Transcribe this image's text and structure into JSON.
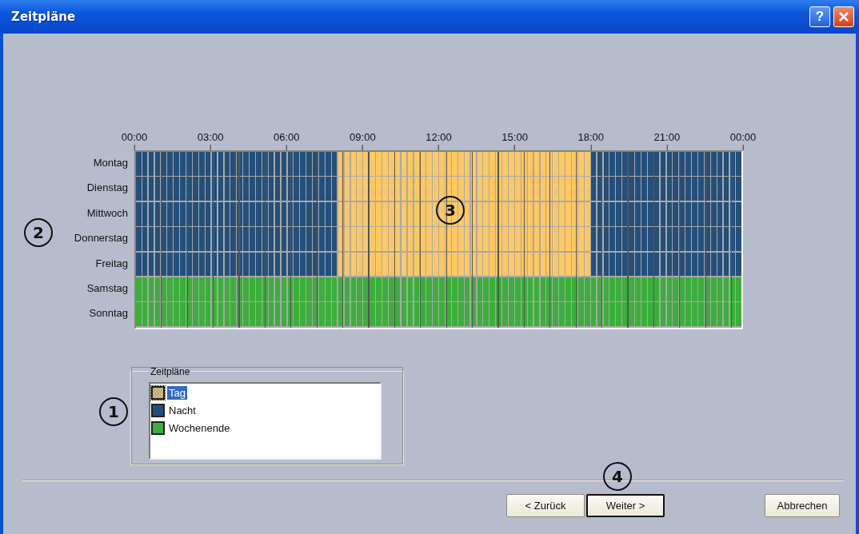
{
  "window": {
    "title": "Zeitpläne",
    "controls": [
      {
        "kind": "help",
        "label": "?"
      },
      {
        "kind": "close"
      }
    ]
  },
  "timeline": {
    "ticks": [
      "00:00",
      "03:00",
      "06:00",
      "09:00",
      "12:00",
      "15:00",
      "18:00",
      "21:00",
      "00:00"
    ],
    "days": [
      {
        "label": "Montag",
        "hours": [
          {
            "kind": "night"
          },
          {
            "kind": "night"
          },
          {
            "kind": "night"
          },
          {
            "kind": "night"
          },
          {
            "kind": "night"
          },
          {
            "kind": "night"
          },
          {
            "kind": "night"
          },
          {
            "kind": "night"
          },
          {
            "kind": "day"
          },
          {
            "kind": "day"
          },
          {
            "kind": "day"
          },
          {
            "kind": "day"
          },
          {
            "kind": "day"
          },
          {
            "kind": "day"
          },
          {
            "kind": "day"
          },
          {
            "kind": "day"
          },
          {
            "kind": "day"
          },
          {
            "kind": "day"
          },
          {
            "kind": "night"
          },
          {
            "kind": "night"
          },
          {
            "kind": "night"
          },
          {
            "kind": "night"
          },
          {
            "kind": "night"
          },
          {
            "kind": "night"
          }
        ]
      },
      {
        "label": "Dienstag",
        "hours": [
          {
            "kind": "night"
          },
          {
            "kind": "night"
          },
          {
            "kind": "night"
          },
          {
            "kind": "night"
          },
          {
            "kind": "night"
          },
          {
            "kind": "night"
          },
          {
            "kind": "night"
          },
          {
            "kind": "night"
          },
          {
            "kind": "day"
          },
          {
            "kind": "day"
          },
          {
            "kind": "day"
          },
          {
            "kind": "day"
          },
          {
            "kind": "day"
          },
          {
            "kind": "day"
          },
          {
            "kind": "day"
          },
          {
            "kind": "day"
          },
          {
            "kind": "day"
          },
          {
            "kind": "day"
          },
          {
            "kind": "night"
          },
          {
            "kind": "night"
          },
          {
            "kind": "night"
          },
          {
            "kind": "night"
          },
          {
            "kind": "night"
          },
          {
            "kind": "night"
          }
        ]
      },
      {
        "label": "Mittwoch",
        "hours": [
          {
            "kind": "night"
          },
          {
            "kind": "night"
          },
          {
            "kind": "night"
          },
          {
            "kind": "night"
          },
          {
            "kind": "night"
          },
          {
            "kind": "night"
          },
          {
            "kind": "night"
          },
          {
            "kind": "night"
          },
          {
            "kind": "day"
          },
          {
            "kind": "day"
          },
          {
            "kind": "day"
          },
          {
            "kind": "day"
          },
          {
            "kind": "day"
          },
          {
            "kind": "day"
          },
          {
            "kind": "day"
          },
          {
            "kind": "day"
          },
          {
            "kind": "day"
          },
          {
            "kind": "day"
          },
          {
            "kind": "night"
          },
          {
            "kind": "night"
          },
          {
            "kind": "night"
          },
          {
            "kind": "night"
          },
          {
            "kind": "night"
          },
          {
            "kind": "night"
          }
        ]
      },
      {
        "label": "Donnerstag",
        "hours": [
          {
            "kind": "night"
          },
          {
            "kind": "night"
          },
          {
            "kind": "night"
          },
          {
            "kind": "night"
          },
          {
            "kind": "night"
          },
          {
            "kind": "night"
          },
          {
            "kind": "night"
          },
          {
            "kind": "night"
          },
          {
            "kind": "day"
          },
          {
            "kind": "day"
          },
          {
            "kind": "day"
          },
          {
            "kind": "day"
          },
          {
            "kind": "day"
          },
          {
            "kind": "day"
          },
          {
            "kind": "day"
          },
          {
            "kind": "day"
          },
          {
            "kind": "day"
          },
          {
            "kind": "day"
          },
          {
            "kind": "night"
          },
          {
            "kind": "night"
          },
          {
            "kind": "night"
          },
          {
            "kind": "night"
          },
          {
            "kind": "night"
          },
          {
            "kind": "night"
          }
        ]
      },
      {
        "label": "Freitag",
        "hours": [
          {
            "kind": "night"
          },
          {
            "kind": "night"
          },
          {
            "kind": "night"
          },
          {
            "kind": "night"
          },
          {
            "kind": "night"
          },
          {
            "kind": "night"
          },
          {
            "kind": "night"
          },
          {
            "kind": "night"
          },
          {
            "kind": "day"
          },
          {
            "kind": "day"
          },
          {
            "kind": "day"
          },
          {
            "kind": "day"
          },
          {
            "kind": "day"
          },
          {
            "kind": "day"
          },
          {
            "kind": "day"
          },
          {
            "kind": "day"
          },
          {
            "kind": "day"
          },
          {
            "kind": "day"
          },
          {
            "kind": "night"
          },
          {
            "kind": "night"
          },
          {
            "kind": "night"
          },
          {
            "kind": "night"
          },
          {
            "kind": "night"
          },
          {
            "kind": "night"
          }
        ]
      },
      {
        "label": "Samstag",
        "hours": [
          {
            "kind": "weekend"
          },
          {
            "kind": "weekend"
          },
          {
            "kind": "weekend"
          },
          {
            "kind": "weekend"
          },
          {
            "kind": "weekend"
          },
          {
            "kind": "weekend"
          },
          {
            "kind": "weekend"
          },
          {
            "kind": "weekend"
          },
          {
            "kind": "weekend"
          },
          {
            "kind": "weekend"
          },
          {
            "kind": "weekend"
          },
          {
            "kind": "weekend"
          },
          {
            "kind": "weekend"
          },
          {
            "kind": "weekend"
          },
          {
            "kind": "weekend"
          },
          {
            "kind": "weekend"
          },
          {
            "kind": "weekend"
          },
          {
            "kind": "weekend"
          },
          {
            "kind": "weekend"
          },
          {
            "kind": "weekend"
          },
          {
            "kind": "weekend"
          },
          {
            "kind": "weekend"
          },
          {
            "kind": "weekend"
          },
          {
            "kind": "weekend"
          }
        ]
      },
      {
        "label": "Sonntag",
        "hours": [
          {
            "kind": "weekend"
          },
          {
            "kind": "weekend"
          },
          {
            "kind": "weekend"
          },
          {
            "kind": "weekend"
          },
          {
            "kind": "weekend"
          },
          {
            "kind": "weekend"
          },
          {
            "kind": "weekend"
          },
          {
            "kind": "weekend"
          },
          {
            "kind": "weekend"
          },
          {
            "kind": "weekend"
          },
          {
            "kind": "weekend"
          },
          {
            "kind": "weekend"
          },
          {
            "kind": "weekend"
          },
          {
            "kind": "weekend"
          },
          {
            "kind": "weekend"
          },
          {
            "kind": "weekend"
          },
          {
            "kind": "weekend"
          },
          {
            "kind": "weekend"
          },
          {
            "kind": "weekend"
          },
          {
            "kind": "weekend"
          },
          {
            "kind": "weekend"
          },
          {
            "kind": "weekend"
          },
          {
            "kind": "weekend"
          },
          {
            "kind": "weekend"
          }
        ]
      }
    ]
  },
  "schedules": {
    "title": "Zeitpläne",
    "items": [
      {
        "kind": "day",
        "label": "Tag",
        "color": "#ffc864",
        "selected": true
      },
      {
        "kind": "night",
        "label": "Nacht",
        "color": "#234f7a",
        "selected": false
      },
      {
        "kind": "weekend",
        "label": "Wochenende",
        "color": "#3cae3c",
        "selected": false
      }
    ]
  },
  "callouts": [
    {
      "label": "1"
    },
    {
      "label": "2"
    },
    {
      "label": "3"
    },
    {
      "label": "4"
    }
  ],
  "buttons": [
    {
      "kind": "back",
      "label": "< Zurück",
      "default": false
    },
    {
      "kind": "next",
      "label": "Weiter >",
      "default": true
    },
    {
      "kind": "cancel",
      "label": "Abbrechen",
      "default": false
    }
  ]
}
